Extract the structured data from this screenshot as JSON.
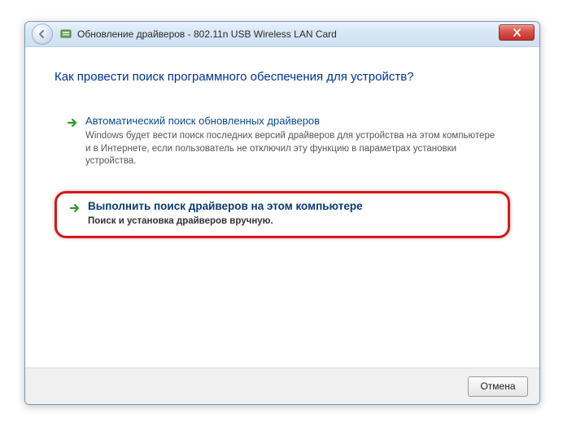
{
  "titlebar": {
    "title": "Обновление драйверов - 802.11n USB Wireless LAN Card"
  },
  "heading": "Как провести поиск программного обеспечения для устройств?",
  "options": [
    {
      "title": "Автоматический поиск обновленных драйверов",
      "desc": "Windows будет вести поиск последних версий драйверов для устройства на этом компьютере и в Интернете, если пользователь не отключил эту функцию в параметрах установки устройства."
    },
    {
      "title": "Выполнить поиск драйверов на этом компьютере",
      "desc": "Поиск и установка драйверов вручную."
    }
  ],
  "footer": {
    "cancel": "Отмена"
  }
}
